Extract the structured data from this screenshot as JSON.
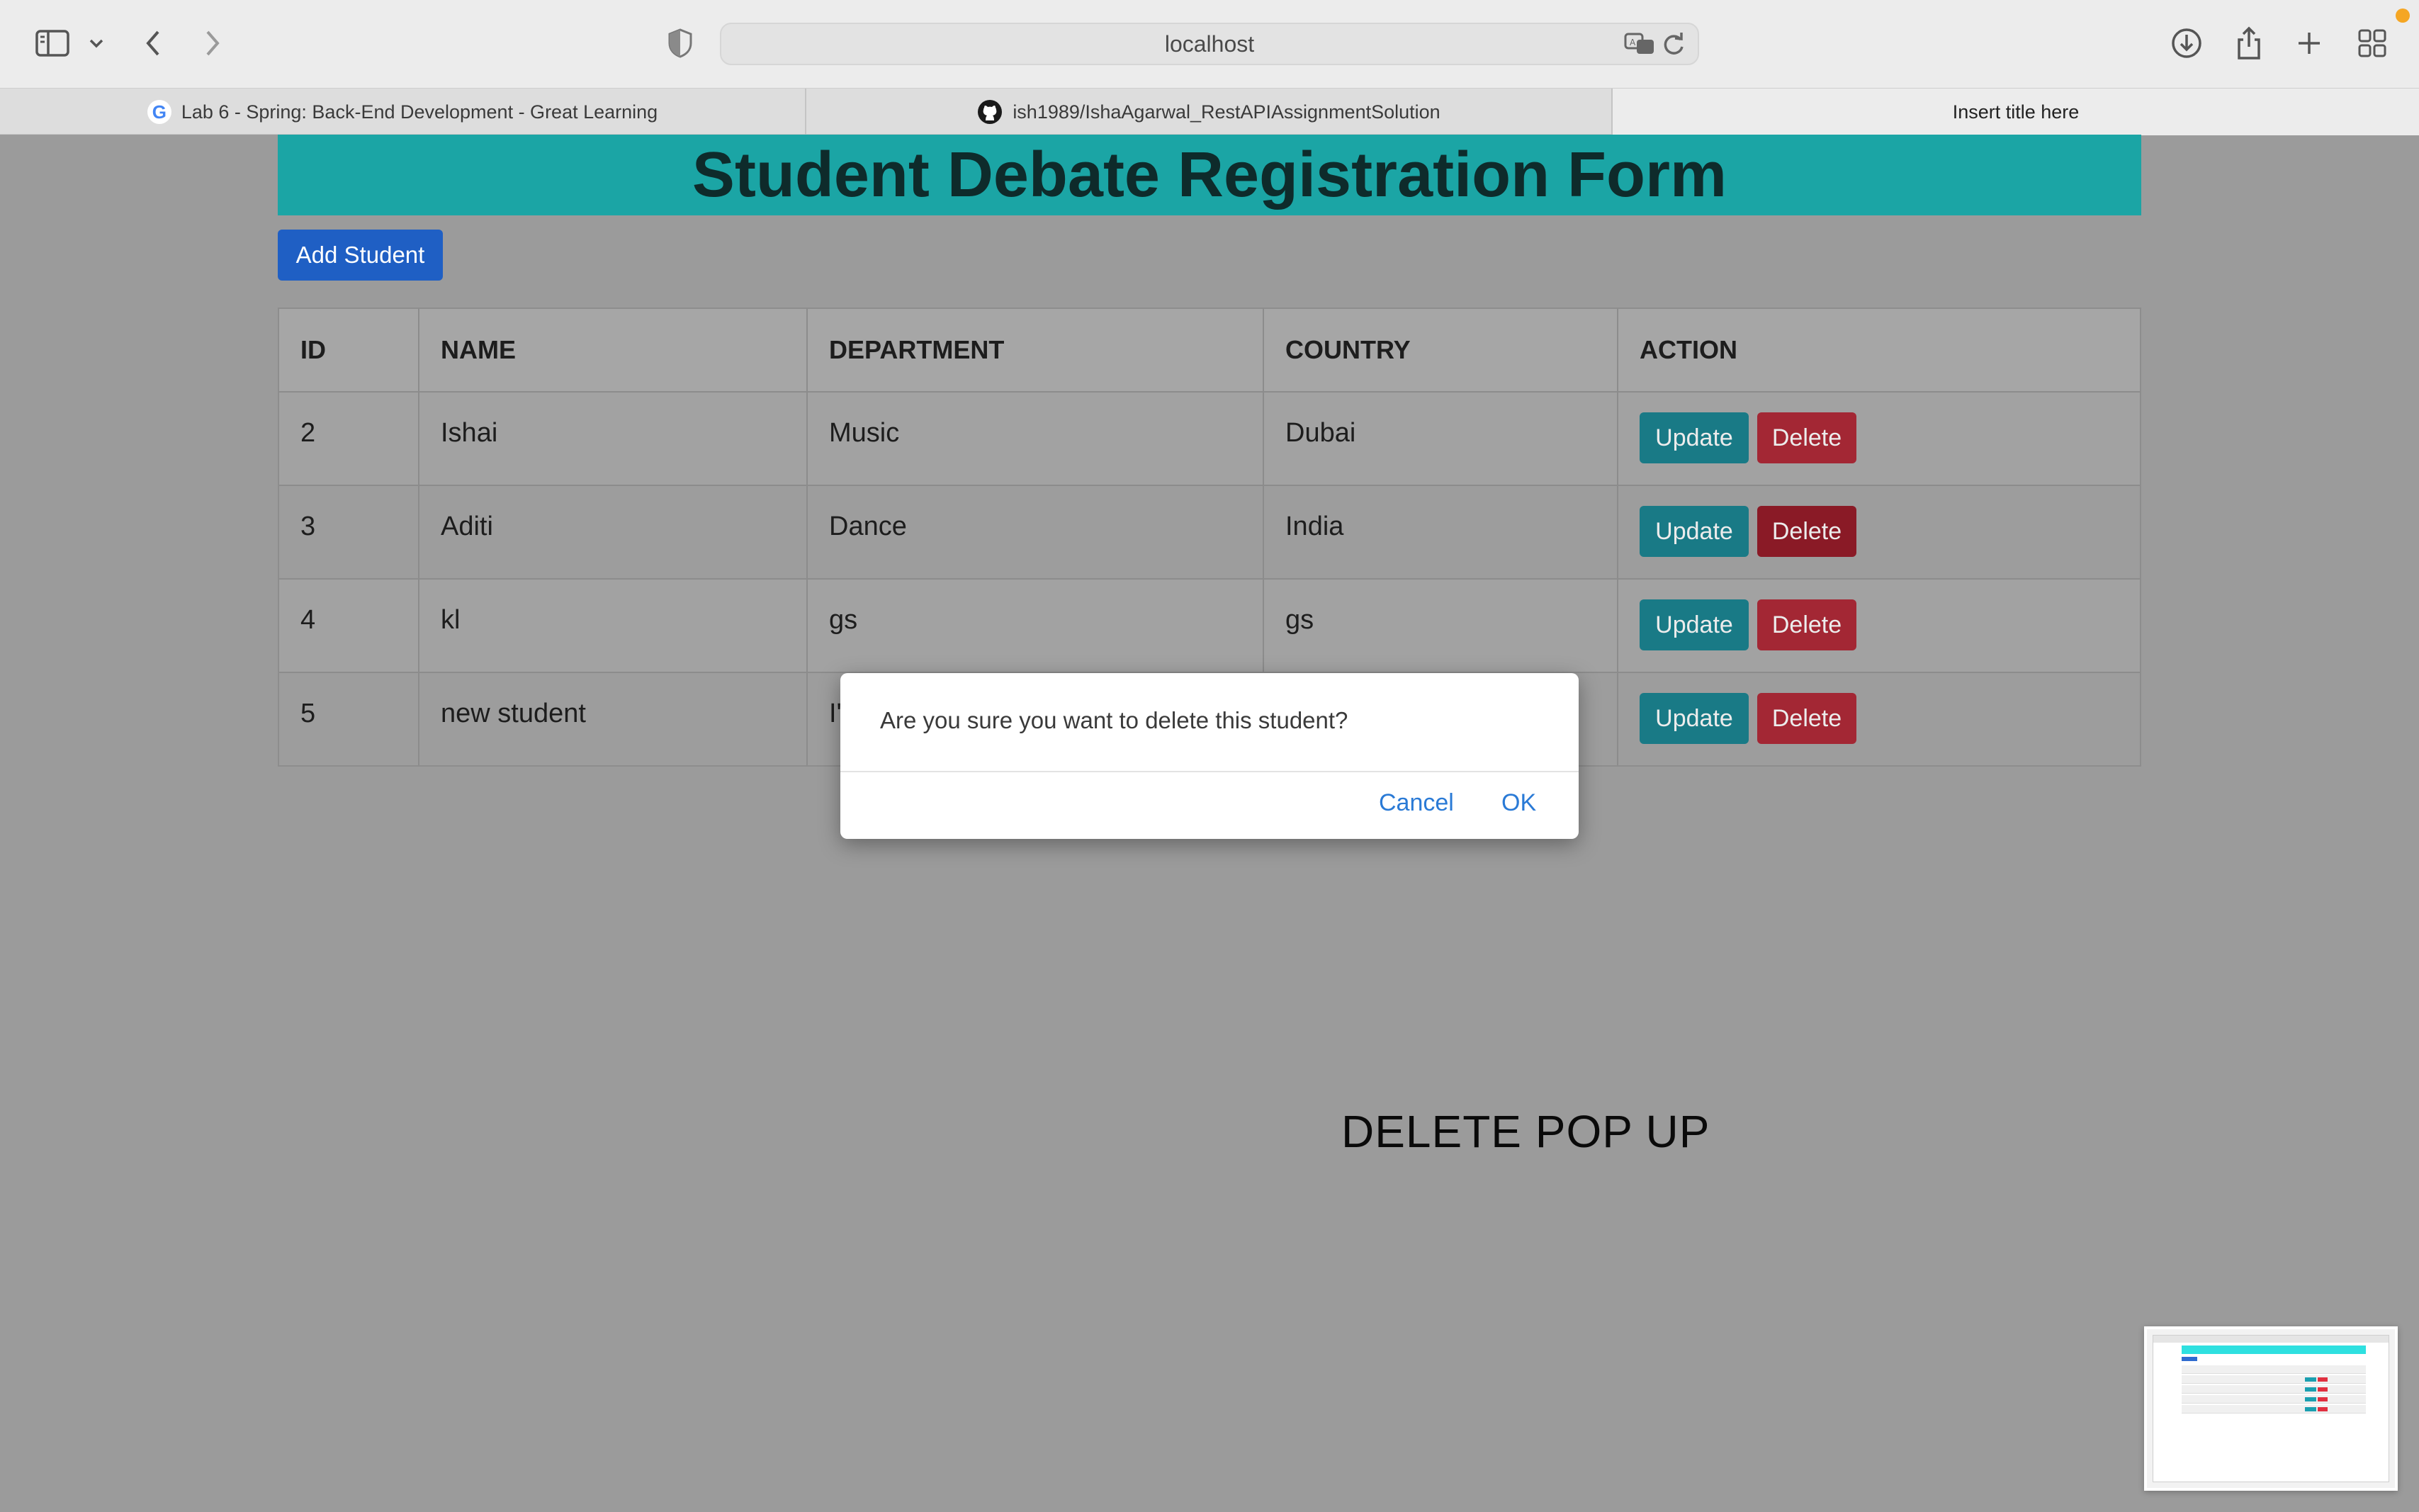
{
  "browser": {
    "url": "localhost",
    "tabs": [
      {
        "label": "Lab 6 - Spring: Back-End Development - Great Learning",
        "favicon": "google-g-icon"
      },
      {
        "label": "ish1989/IshaAgarwal_RestAPIAssignmentSolution",
        "favicon": "github-icon"
      },
      {
        "label": "Insert title here",
        "favicon": ""
      }
    ]
  },
  "page": {
    "title": "Student Debate Registration Form",
    "add_button": "Add Student",
    "table": {
      "columns": [
        "ID",
        "NAME",
        "DEPARTMENT",
        "COUNTRY",
        "ACTION"
      ],
      "rows": [
        {
          "id": "2",
          "name": "Ishai",
          "department": "Music",
          "country": "Dubai"
        },
        {
          "id": "3",
          "name": "Aditi",
          "department": "Dance",
          "country": "India"
        },
        {
          "id": "4",
          "name": "kl",
          "department": "gs",
          "country": "gs"
        },
        {
          "id": "5",
          "name": "new student",
          "department": "I'",
          "country": ""
        }
      ],
      "update_label": "Update",
      "delete_label": "Delete"
    }
  },
  "dialog": {
    "message": "Are you sure you want to delete this student?",
    "cancel": "Cancel",
    "ok": "OK"
  },
  "caption": "DELETE POP UP",
  "colors": {
    "header_bg": "#1ba5a5",
    "add_button": "#1f5fc4",
    "update_button": "#197a86",
    "delete_button": "#a32734",
    "dialog_link": "#2a7ad6"
  }
}
